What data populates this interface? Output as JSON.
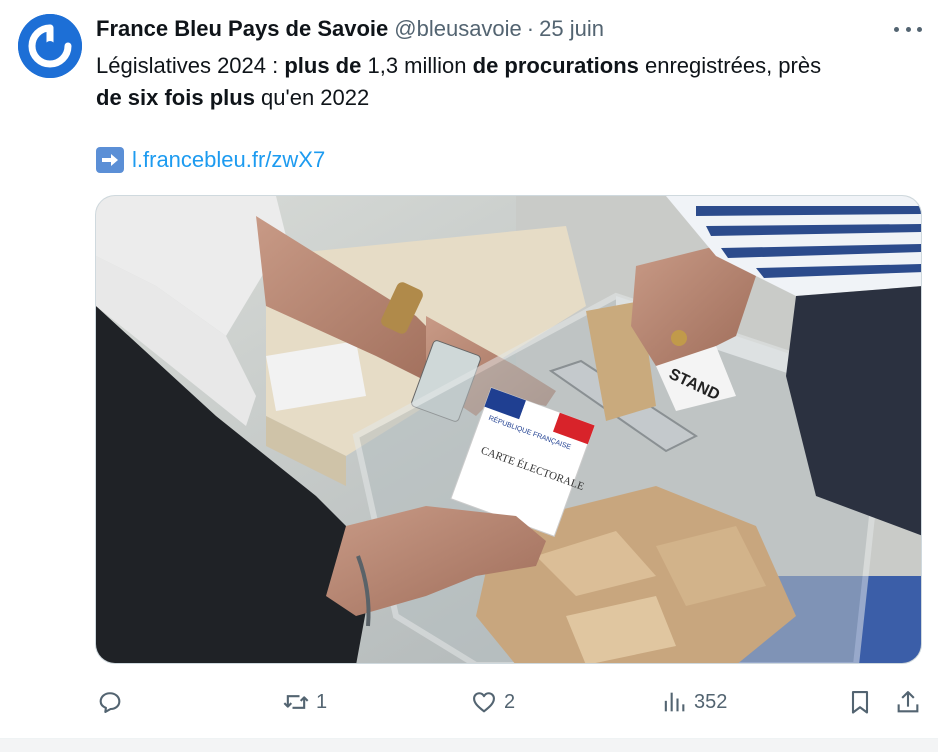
{
  "author": {
    "name": "France Bleu Pays de Savoie",
    "handle": "@bleusavoie",
    "separator": "·",
    "date": "25 juin"
  },
  "tweet": {
    "text_parts": [
      {
        "text": "Législatives 2024 : ",
        "bold": false
      },
      {
        "text": "plus de",
        "bold": true
      },
      {
        "text": " 1,3 million ",
        "bold": false
      },
      {
        "text": "de procurations",
        "bold": true
      },
      {
        "text": " enregistrées, près ",
        "bold": false
      },
      {
        "text": "de six fois plus",
        "bold": true
      },
      {
        "text": " qu'en 2022",
        "bold": false
      }
    ],
    "link_icon": "right-arrow-emoji",
    "link_text": "l.francebleu.fr/zwX7",
    "media": {
      "kind": "photo",
      "ballot_card_header": "RÉPUBLIQUE FRANÇAISE",
      "ballot_card_title": "CARTE ÉLECTORALE",
      "sign_text": "STAND"
    }
  },
  "actions": {
    "reply": {
      "icon": "reply-icon",
      "count": ""
    },
    "retweet": {
      "icon": "retweet-icon",
      "count": "1"
    },
    "like": {
      "icon": "heart-icon",
      "count": "2"
    },
    "views": {
      "icon": "views-icon",
      "count": "352"
    },
    "bookmark": {
      "icon": "bookmark-icon"
    },
    "share": {
      "icon": "share-icon"
    }
  },
  "colors": {
    "text": "#0f1419",
    "muted": "#536471",
    "link": "#1d9bf0",
    "avatar_bg": "#1d6fd6"
  }
}
